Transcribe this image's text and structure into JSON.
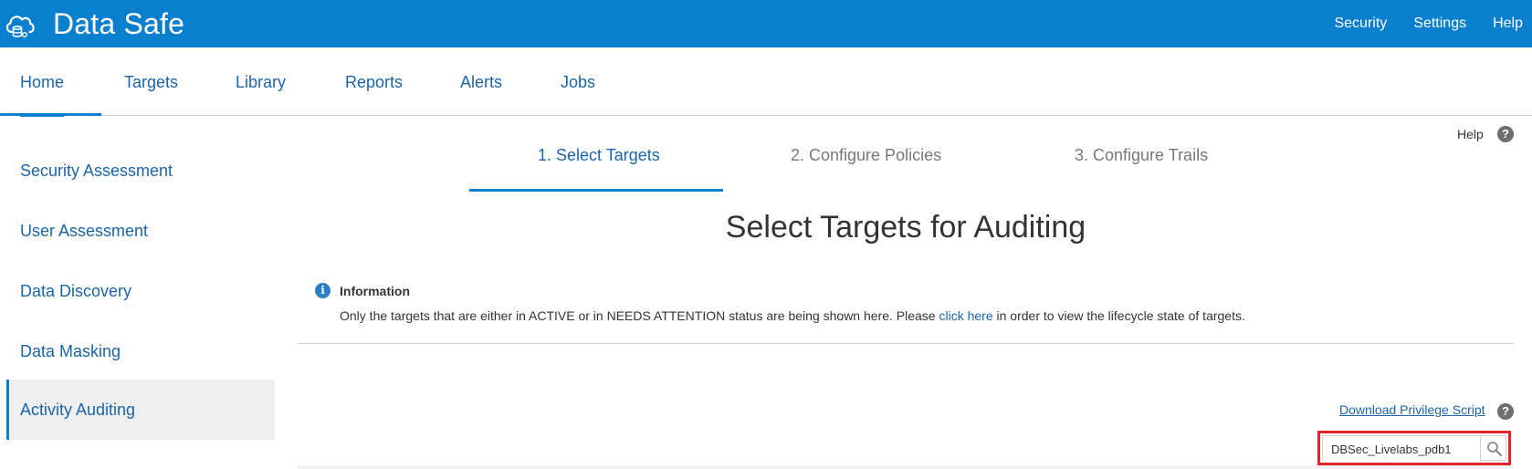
{
  "app": {
    "title": "Data Safe",
    "logo_icon": "cloud-database-icon"
  },
  "topnav": {
    "items": [
      "Security",
      "Settings",
      "Help"
    ]
  },
  "mainnav": {
    "tabs": [
      "Home",
      "Targets",
      "Library",
      "Reports",
      "Alerts",
      "Jobs"
    ],
    "active": "Home"
  },
  "sidebar": {
    "items": [
      "Security Assessment",
      "User Assessment",
      "Data Discovery",
      "Data Masking",
      "Activity Auditing"
    ],
    "active": "Activity Auditing"
  },
  "help": {
    "label": "Help",
    "icon": "question-icon"
  },
  "wizard": {
    "steps": [
      "1. Select Targets",
      "2. Configure Policies",
      "3. Configure Trails"
    ],
    "active": "1. Select Targets",
    "title": "Select Targets for Auditing"
  },
  "info": {
    "icon": "info-icon",
    "title": "Information",
    "text_before": "Only the targets that are either in ACTIVE or in NEEDS ATTENTION status are being shown here. Please ",
    "link": "click here",
    "text_after": " in order to view the lifecycle state of targets."
  },
  "download": {
    "label": "Download Privilege Script"
  },
  "search": {
    "value": "DBSec_Livelabs_pdb1",
    "icon": "search-icon"
  },
  "colors": {
    "brand_blue": "#0a7fcd",
    "link_blue": "#1b64a8",
    "highlight_red": "#e0252b"
  }
}
